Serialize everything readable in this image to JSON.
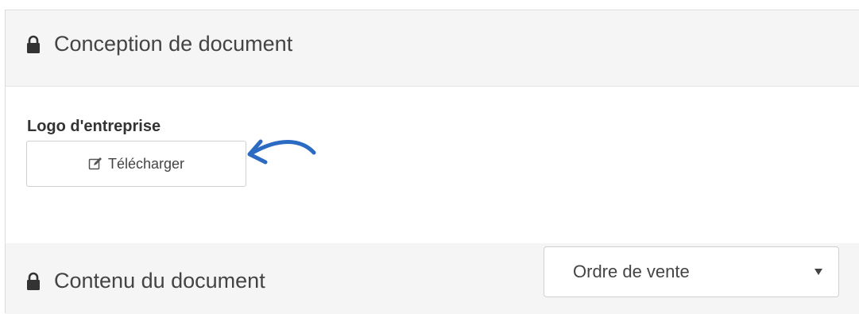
{
  "sections": {
    "design": {
      "title": "Conception de document",
      "icon": "lock-icon"
    },
    "content": {
      "title": "Contenu du document",
      "icon": "lock-icon"
    }
  },
  "logo_field": {
    "label": "Logo d'entreprise",
    "upload_button": {
      "label": "Télécharger",
      "icon": "edit-icon"
    }
  },
  "document_type_select": {
    "selected": "Ordre de vente",
    "icon": "caret-down-icon"
  },
  "annotation": {
    "type": "arrow",
    "color": "#2b6cc2"
  },
  "colors": {
    "heading_bg": "#f5f5f5",
    "border": "#dcdcdc",
    "text": "#444444",
    "annotation": "#2b6cc2"
  }
}
